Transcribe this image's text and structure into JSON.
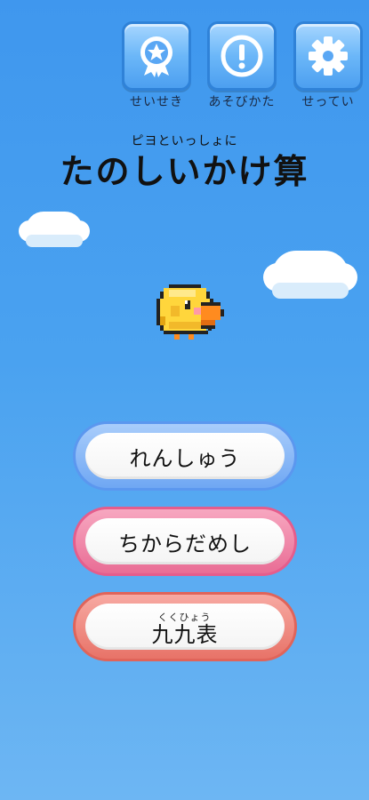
{
  "top_buttons": [
    {
      "icon": "medal-icon",
      "label": "せいせき"
    },
    {
      "icon": "exclamation-icon",
      "label": "あそびかた"
    },
    {
      "icon": "gear-icon",
      "label": "せってい"
    }
  ],
  "title": {
    "ruby": "ピヨといっしょに",
    "text": "たのしいかけ算"
  },
  "menu": {
    "practice": "れんしゅう",
    "challenge": "ちからだめし",
    "table": "九九表",
    "table_ruby": "くくひょう"
  },
  "colors": {
    "sky": "#4aa2f0",
    "practice_border": "#5b97ef",
    "challenge_border": "#e55d8c",
    "table_border": "#e0645a"
  }
}
